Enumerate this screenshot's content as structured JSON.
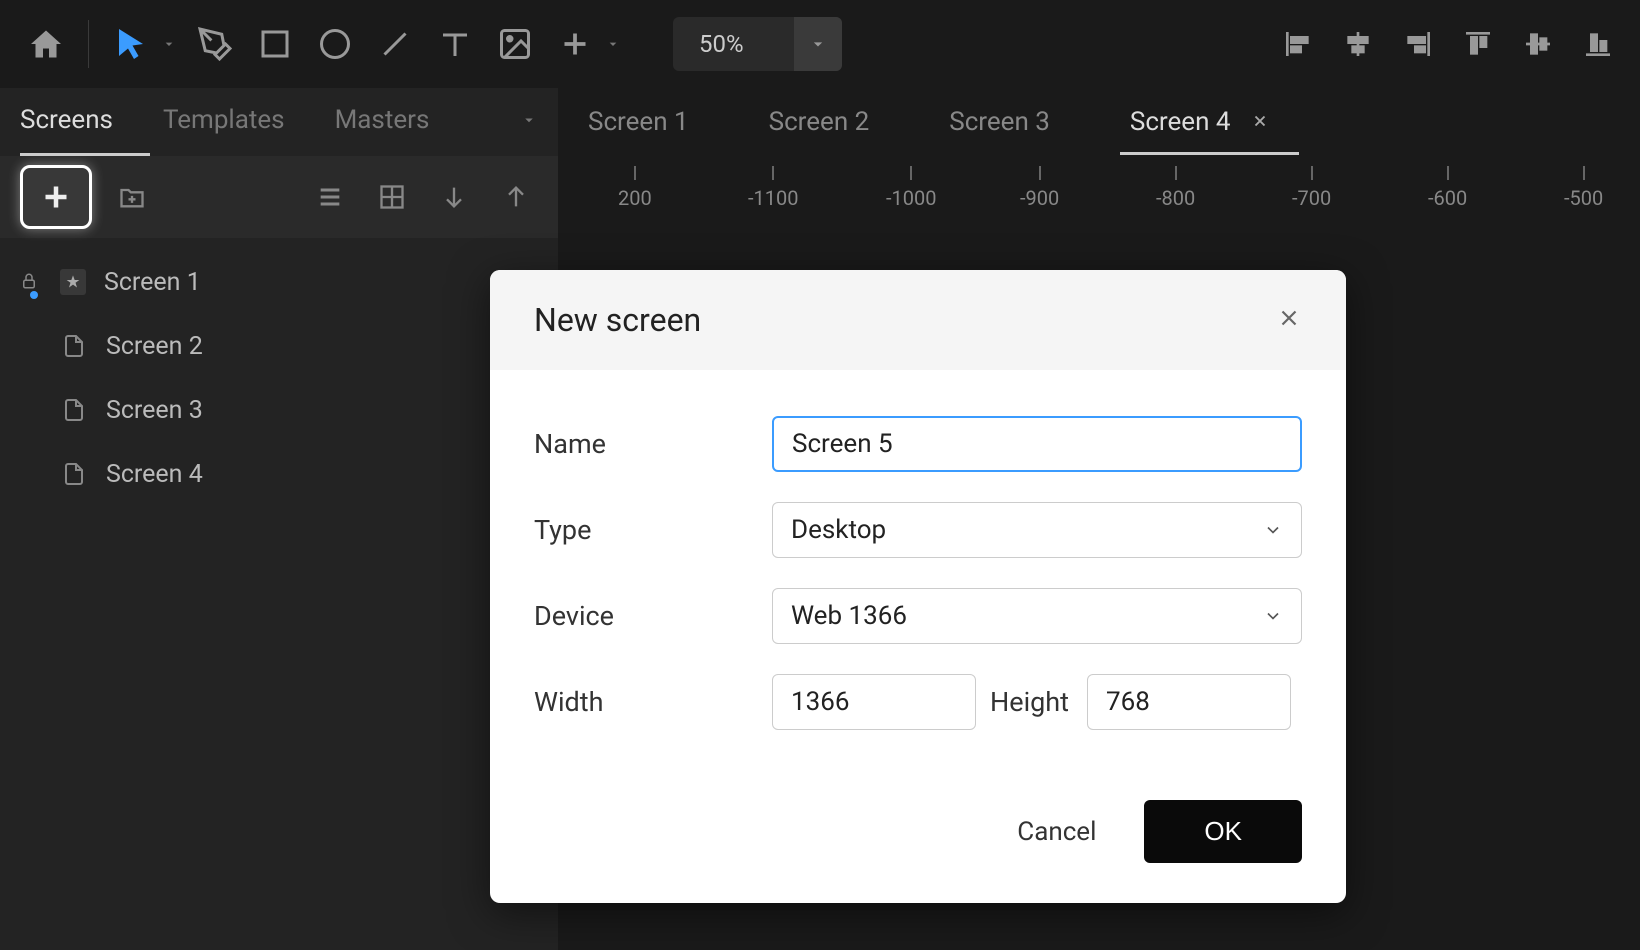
{
  "toolbar": {
    "zoom": "50%"
  },
  "sidebar": {
    "tabs": [
      "Screens",
      "Templates",
      "Masters"
    ],
    "active_tab": 0,
    "screens": [
      "Screen 1",
      "Screen 2",
      "Screen 3",
      "Screen 4"
    ]
  },
  "canvas": {
    "tabs": [
      "Screen 1",
      "Screen 2",
      "Screen 3",
      "Screen 4"
    ],
    "active_tab": 3,
    "ruler_marks": [
      "200",
      "-1100",
      "-1000",
      "-900",
      "-800",
      "-700",
      "-600",
      "-500"
    ]
  },
  "dialog": {
    "title": "New screen",
    "name_label": "Name",
    "name_value": "Screen 5",
    "type_label": "Type",
    "type_value": "Desktop",
    "device_label": "Device",
    "device_value": "Web 1366",
    "width_label": "Width",
    "width_value": "1366",
    "height_label": "Height",
    "height_value": "768",
    "cancel": "Cancel",
    "ok": "OK"
  }
}
